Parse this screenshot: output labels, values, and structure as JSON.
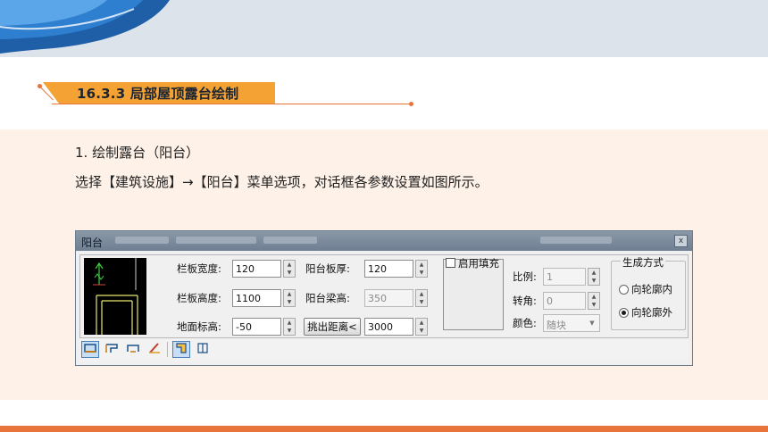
{
  "section": {
    "title": "16.3.3 局部屋顶露台绘制"
  },
  "paragraphs": {
    "p1": "1. 绘制露台（阳台）",
    "p2": "选择【建筑设施】→【阳台】菜单选项，对话框各参数设置如图所示。"
  },
  "dialog": {
    "title": "阳台",
    "close_label": "x",
    "fields": {
      "rail_width_label": "栏板宽度:",
      "rail_width_value": "120",
      "rail_height_label": "栏板高度:",
      "rail_height_value": "1100",
      "ground_elev_label": "地面标高:",
      "ground_elev_value": "-50",
      "slab_thick_label": "阳台板厚:",
      "slab_thick_value": "120",
      "beam_height_label": "阳台梁高:",
      "beam_height_value": "350",
      "overhang_button": "挑出距离<",
      "overhang_value": "3000"
    },
    "fill": {
      "enable_label": "启用填充",
      "scale_label": "比例:",
      "scale_value": "1",
      "angle_label": "转角:",
      "angle_value": "0",
      "color_label": "颜色:",
      "color_value": "随块"
    },
    "gen": {
      "group_label": "生成方式",
      "inner_label": "向轮廓内",
      "outer_label": "向轮廓外",
      "selected": "outer"
    }
  }
}
